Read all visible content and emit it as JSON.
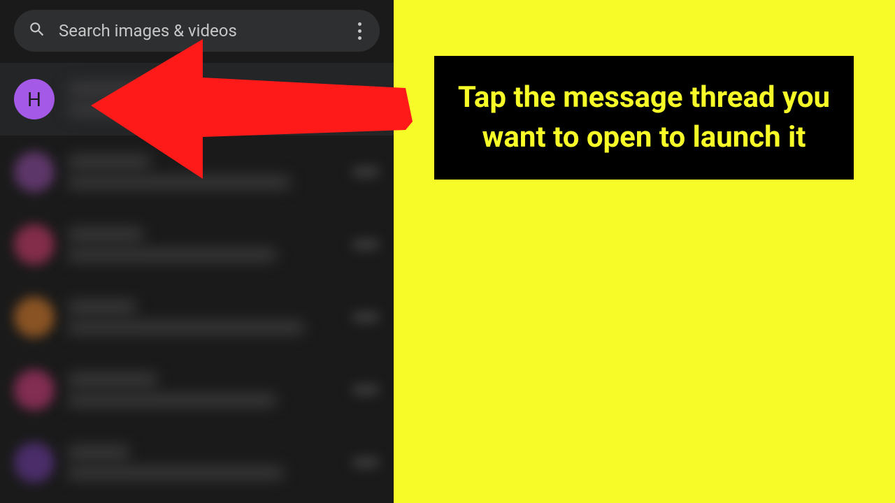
{
  "search": {
    "placeholder": "Search images & videos"
  },
  "threads": [
    {
      "avatar_letter": "H",
      "avatar_color": "#a45ae6",
      "highlighted": true
    },
    {
      "avatar_letter": "",
      "avatar_color": "#8b4a9e",
      "highlighted": false
    },
    {
      "avatar_letter": "",
      "avatar_color": "#c93a6a",
      "highlighted": false
    },
    {
      "avatar_letter": "",
      "avatar_color": "#d47a2a",
      "highlighted": false
    },
    {
      "avatar_letter": "",
      "avatar_color": "#c73a78",
      "highlighted": false
    },
    {
      "avatar_letter": "",
      "avatar_color": "#6a3a9e",
      "highlighted": false
    }
  ],
  "callout": {
    "text": "Tap the message thread you want to open to launch it"
  },
  "colors": {
    "background": "#f7fc29",
    "panel": "#1a1a1a",
    "arrow": "#ff1a1a",
    "callout_bg": "#000000",
    "callout_text": "#f7fc29"
  }
}
